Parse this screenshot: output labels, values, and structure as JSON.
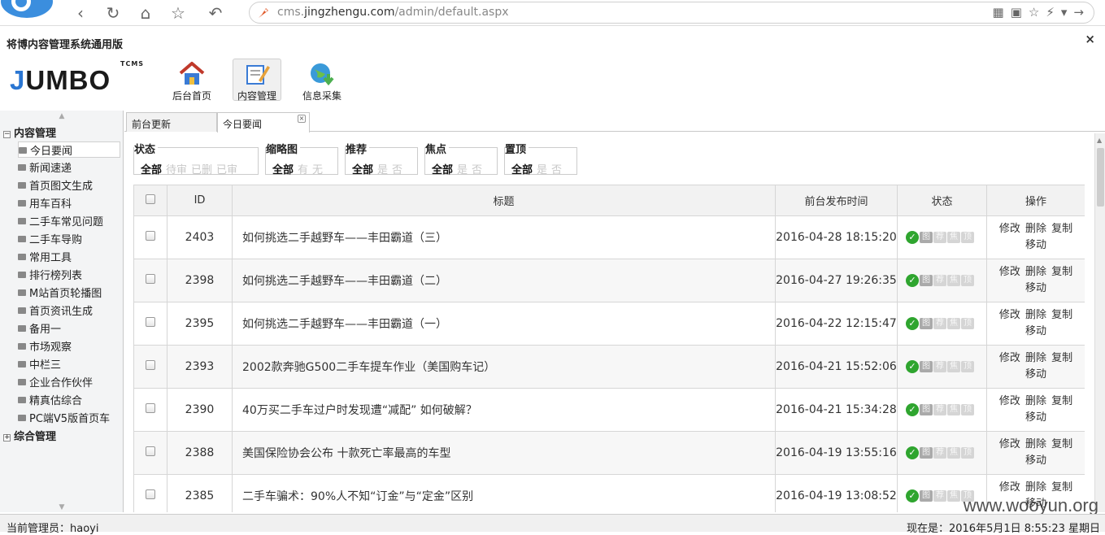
{
  "browser": {
    "url_prefix": "cms.",
    "url_domain": "jingzhengu.com",
    "url_path": "/admin/default.aspx",
    "nav_back": "‹",
    "nav_reload": "↻",
    "nav_home": "⌂",
    "nav_star": "☆",
    "nav_undo": "↶",
    "tool_qr": "▦",
    "tool_read": "▣",
    "tool_fav": "☆",
    "tool_flash": "⚡",
    "tool_menu": "▾",
    "tool_forward": "→"
  },
  "app": {
    "title": "将博内容管理系统通用版",
    "close": "×",
    "logo_j": "J",
    "logo_rest": "UMBO",
    "logo_sup": "TCMS"
  },
  "top_nav": [
    {
      "label": "后台首页",
      "icon": "home-icon"
    },
    {
      "label": "内容管理",
      "icon": "edit-icon"
    },
    {
      "label": "信息采集",
      "icon": "globe-download-icon"
    }
  ],
  "sidebar": {
    "groups": [
      {
        "label": "内容管理",
        "toggle": "−"
      },
      {
        "label": "综合管理",
        "toggle": "+"
      }
    ],
    "items": [
      "今日要闻",
      "新闻速递",
      "首页图文生成",
      "用车百科",
      "二手车常见问题",
      "二手车导购",
      "常用工具",
      "排行榜列表",
      "M站首页轮播图",
      "首页资讯生成",
      "备用一",
      "市场观察",
      "中栏三",
      "企业合作伙伴",
      "精真估综合",
      "PC端V5版首页车"
    ]
  },
  "tabs": [
    {
      "label": "前台更新"
    },
    {
      "label": "今日要闻"
    }
  ],
  "filters": [
    {
      "title": "状态",
      "options": [
        "全部",
        "待审",
        "已删",
        "已审"
      ]
    },
    {
      "title": "缩略图",
      "options": [
        "全部",
        "有",
        "无"
      ]
    },
    {
      "title": "推荐",
      "options": [
        "全部",
        "是",
        "否"
      ]
    },
    {
      "title": "焦点",
      "options": [
        "全部",
        "是",
        "否"
      ]
    },
    {
      "title": "置顶",
      "options": [
        "全部",
        "是",
        "否"
      ]
    }
  ],
  "table": {
    "headers": {
      "id": "ID",
      "title": "标题",
      "time": "前台发布时间",
      "status": "状态",
      "ops": "操作"
    },
    "badges": [
      "图",
      "荐",
      "焦",
      "顶"
    ],
    "ops": {
      "edit": "修改",
      "delete": "删除",
      "copy": "复制",
      "move": "移动"
    },
    "rows": [
      {
        "id": "2403",
        "title": "如何挑选二手越野车——丰田霸道（三）",
        "time": "2016-04-28 18:15:20"
      },
      {
        "id": "2398",
        "title": "如何挑选二手越野车——丰田霸道（二）",
        "time": "2016-04-27 19:26:35"
      },
      {
        "id": "2395",
        "title": "如何挑选二手越野车——丰田霸道（一）",
        "time": "2016-04-22 12:15:47"
      },
      {
        "id": "2393",
        "title": "2002款奔驰G500二手车提车作业（美国购车记）",
        "time": "2016-04-21 15:52:06"
      },
      {
        "id": "2390",
        "title": "40万买二手车过户时发现遭“减配” 如何破解？",
        "time": "2016-04-21 15:34:28"
      },
      {
        "id": "2388",
        "title": "美国保险协会公布 十款死亡率最高的车型",
        "time": "2016-04-19 13:55:16"
      },
      {
        "id": "2385",
        "title": "二手车骗术：90%人不知“订金”与“定金”区别",
        "time": "2016-04-19 13:08:52"
      }
    ]
  },
  "status_bar": {
    "left": "当前管理员：haoyi",
    "right": "现在是：2016年5月1日 8:55:23 星期日"
  },
  "watermark": "www.wooyun.org"
}
